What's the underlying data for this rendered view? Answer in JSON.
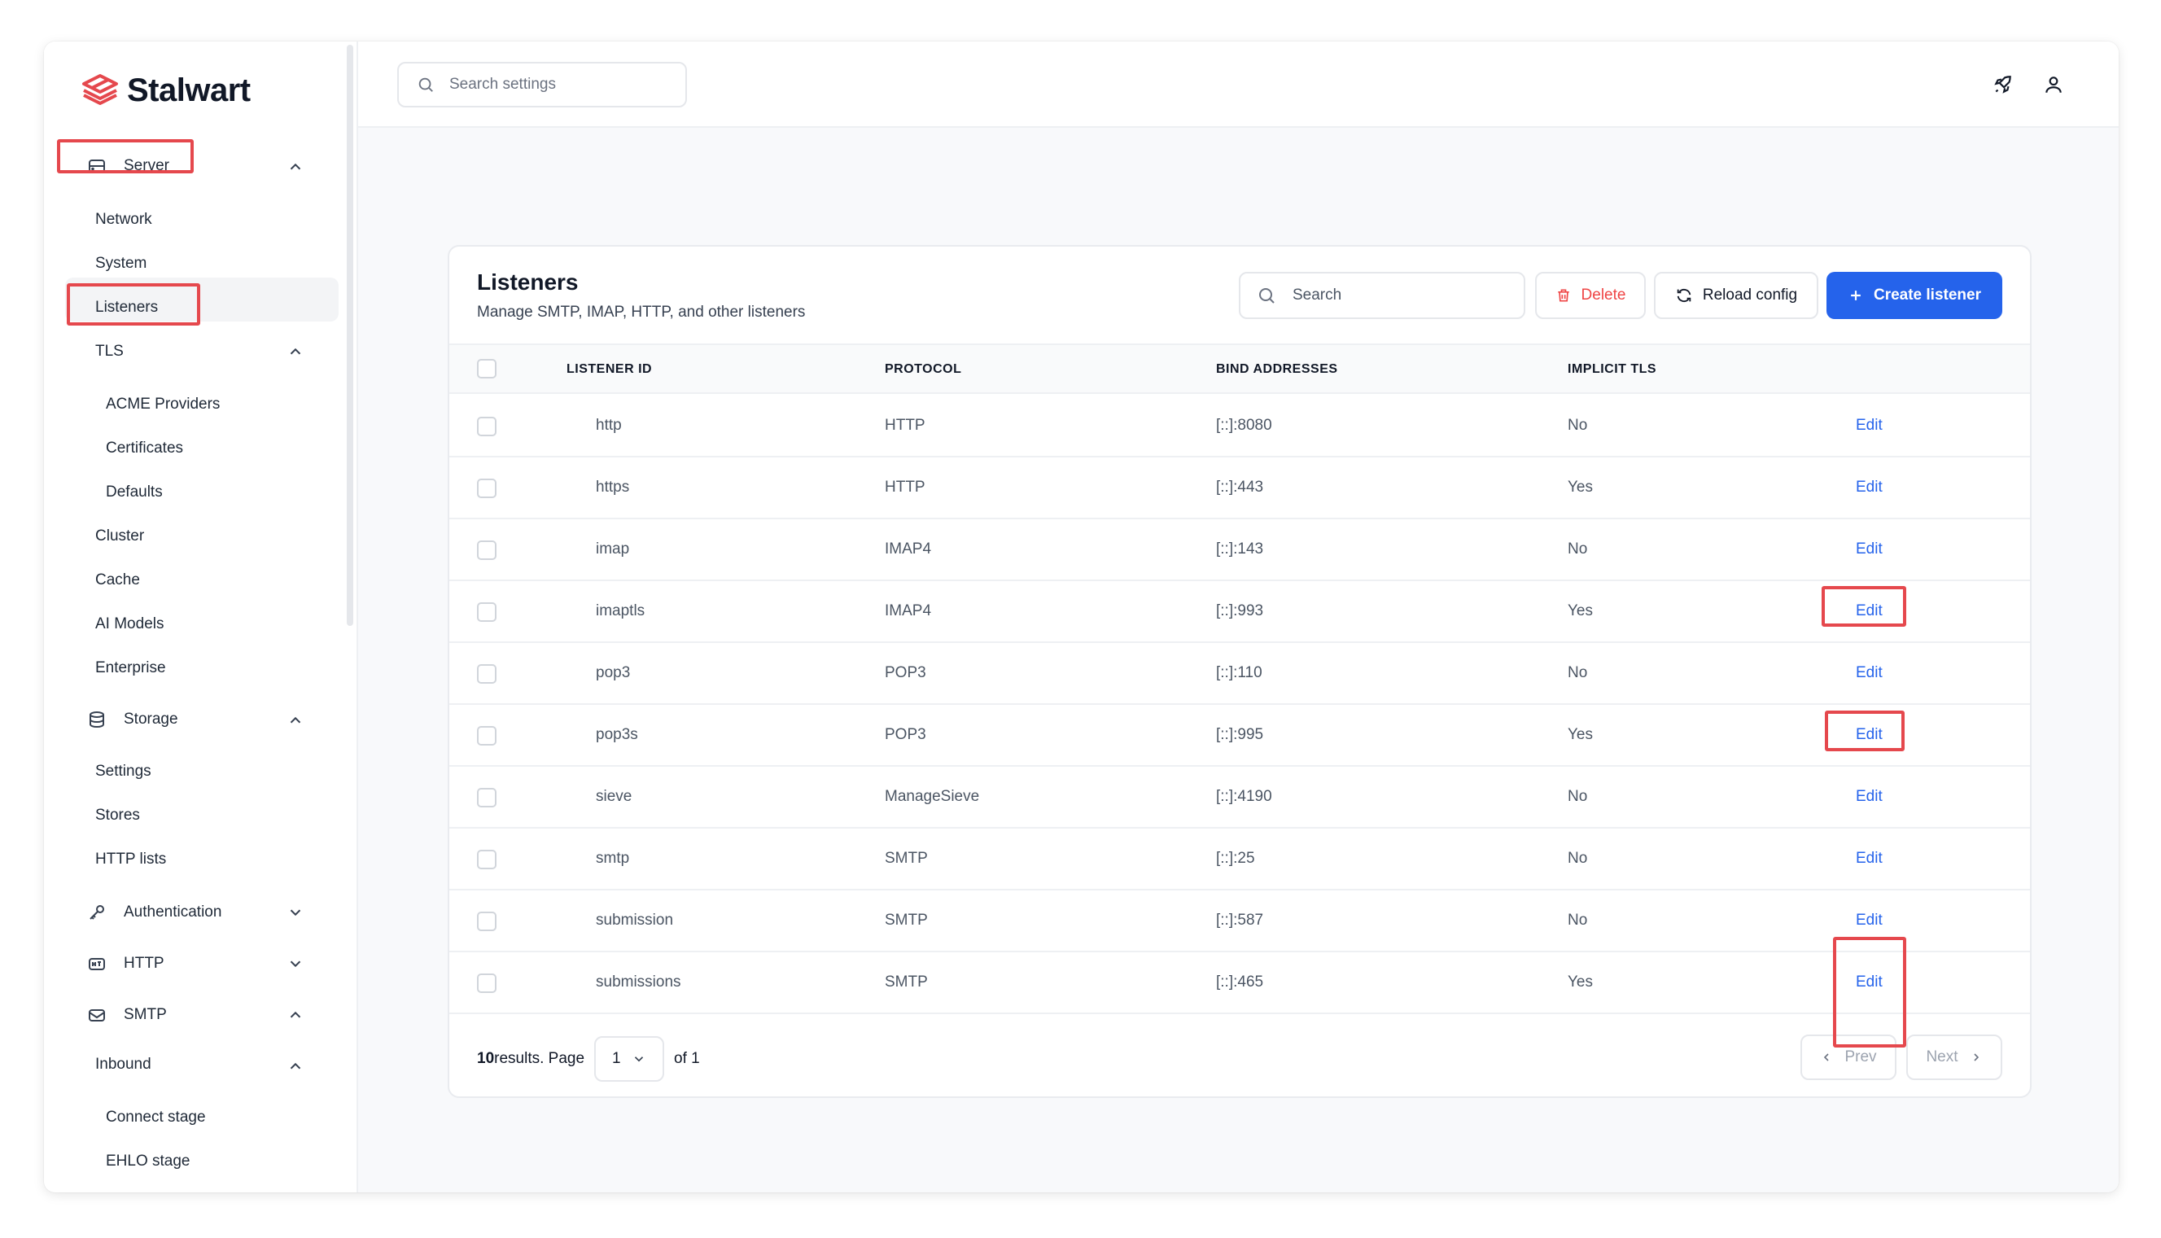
{
  "app": {
    "logo_text": "Stalwart"
  },
  "colors": {
    "brand": "#e5484d",
    "accent": "#2563eb",
    "delete": "#ef4444",
    "highlight": "#e5484d"
  },
  "sidebar": {
    "server": {
      "label": "Server",
      "icon": "server-icon"
    },
    "server_items": [
      "Network",
      "System",
      "Listeners"
    ],
    "tls": {
      "label": "TLS"
    },
    "tls_items": [
      "ACME Providers",
      "Certificates",
      "Defaults"
    ],
    "server_items_2": [
      "Cluster",
      "Cache",
      "AI Models",
      "Enterprise"
    ],
    "storage": {
      "label": "Storage",
      "icon": "database-icon"
    },
    "storage_items": [
      "Settings",
      "Stores",
      "HTTP lists"
    ],
    "authentication": {
      "label": "Authentication",
      "icon": "key-icon"
    },
    "http": {
      "label": "HTTP",
      "icon": "http-icon"
    },
    "smtp": {
      "label": "SMTP",
      "icon": "mail-icon"
    },
    "inbound": {
      "label": "Inbound"
    },
    "inbound_items": [
      "Connect stage",
      "EHLO stage"
    ]
  },
  "header": {
    "search_placeholder": "Search settings",
    "rocket_icon": "rocket-icon",
    "user_icon": "user-icon"
  },
  "card": {
    "title": "Listeners",
    "subtitle": "Manage SMTP, IMAP, HTTP, and other listeners",
    "search_placeholder": "Search",
    "delete_label": "Delete",
    "reload_label": "Reload config",
    "create_label": "Create listener",
    "columns": [
      "LISTENER ID",
      "PROTOCOL",
      "BIND ADDRESSES",
      "IMPLICIT TLS"
    ],
    "edit_label": "Edit",
    "rows": [
      {
        "id": "http",
        "protocol": "HTTP",
        "bind": "[::]:8080",
        "tls": "No"
      },
      {
        "id": "https",
        "protocol": "HTTP",
        "bind": "[::]:443",
        "tls": "Yes"
      },
      {
        "id": "imap",
        "protocol": "IMAP4",
        "bind": "[::]:143",
        "tls": "No"
      },
      {
        "id": "imaptls",
        "protocol": "IMAP4",
        "bind": "[::]:993",
        "tls": "Yes"
      },
      {
        "id": "pop3",
        "protocol": "POP3",
        "bind": "[::]:110",
        "tls": "No"
      },
      {
        "id": "pop3s",
        "protocol": "POP3",
        "bind": "[::]:995",
        "tls": "Yes"
      },
      {
        "id": "sieve",
        "protocol": "ManageSieve",
        "bind": "[::]:4190",
        "tls": "No"
      },
      {
        "id": "smtp",
        "protocol": "SMTP",
        "bind": "[::]:25",
        "tls": "No"
      },
      {
        "id": "submission",
        "protocol": "SMTP",
        "bind": "[::]:587",
        "tls": "No"
      },
      {
        "id": "submissions",
        "protocol": "SMTP",
        "bind": "[::]:465",
        "tls": "Yes"
      }
    ],
    "footer": {
      "count": "10",
      "results_text": " results. Page",
      "page": "1",
      "of_text": "of 1",
      "prev_label": "Prev",
      "next_label": "Next"
    }
  }
}
